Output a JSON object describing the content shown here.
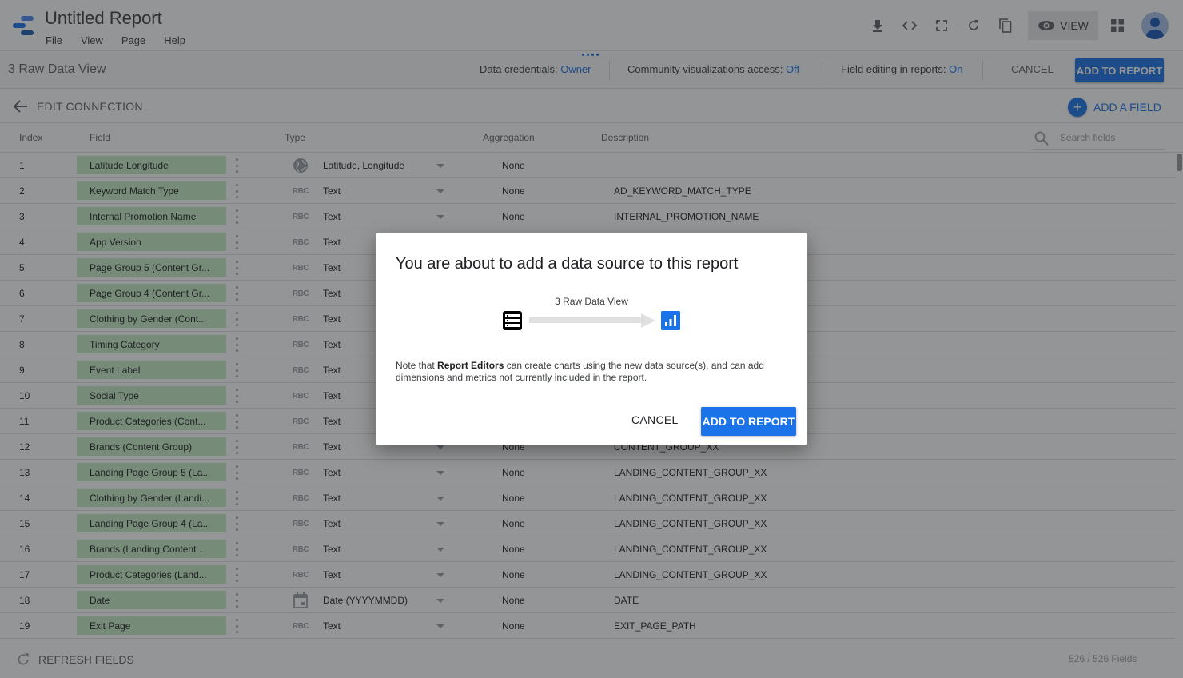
{
  "app": {
    "title": "Untitled Report",
    "menu": [
      "File",
      "View",
      "Page",
      "Help"
    ],
    "toolbar": {
      "download_icon": "download-icon",
      "embed_icon": "code-icon",
      "fullscreen_icon": "fullscreen-icon",
      "refresh_icon": "refresh-icon",
      "copy_icon": "copy-icon",
      "view_label": "VIEW",
      "apps_icon": "apps-grid-icon",
      "avatar_icon": "account-icon"
    }
  },
  "subbar": {
    "datasource_name": "3 Raw Data View",
    "credentials_label": "Data credentials:",
    "credentials_value": "Owner",
    "community_label": "Community visualizations access:",
    "community_value": "Off",
    "field_editing_label": "Field editing in reports:",
    "field_editing_value": "On",
    "cancel_label": "CANCEL",
    "add_label": "ADD TO REPORT"
  },
  "editbar": {
    "back_label": "EDIT CONNECTION",
    "add_field_label": "ADD A FIELD"
  },
  "table": {
    "headers": {
      "index": "Index",
      "field": "Field",
      "type": "Type",
      "aggregation": "Aggregation",
      "description": "Description"
    },
    "search_placeholder": "Search fields",
    "rows": [
      {
        "index": "1",
        "field": "Latitude Longitude",
        "type_icon": "globe",
        "type": "Latitude, Longitude",
        "aggregation": "None",
        "description": ""
      },
      {
        "index": "2",
        "field": "Keyword Match Type",
        "type_icon": "abc",
        "type": "Text",
        "aggregation": "None",
        "description": "AD_KEYWORD_MATCH_TYPE"
      },
      {
        "index": "3",
        "field": "Internal Promotion Name",
        "type_icon": "abc",
        "type": "Text",
        "aggregation": "None",
        "description": "INTERNAL_PROMOTION_NAME"
      },
      {
        "index": "4",
        "field": "App Version",
        "type_icon": "abc",
        "type": "Text",
        "aggregation": "",
        "description": ""
      },
      {
        "index": "5",
        "field": "Page Group 5 (Content Gr...",
        "type_icon": "abc",
        "type": "Text",
        "aggregation": "",
        "description": ""
      },
      {
        "index": "6",
        "field": "Page Group 4 (Content Gr...",
        "type_icon": "abc",
        "type": "Text",
        "aggregation": "",
        "description": ""
      },
      {
        "index": "7",
        "field": "Clothing by Gender (Cont...",
        "type_icon": "abc",
        "type": "Text",
        "aggregation": "",
        "description": ""
      },
      {
        "index": "8",
        "field": "Timing Category",
        "type_icon": "abc",
        "type": "Text",
        "aggregation": "",
        "description": ""
      },
      {
        "index": "9",
        "field": "Event Label",
        "type_icon": "abc",
        "type": "Text",
        "aggregation": "",
        "description": ""
      },
      {
        "index": "10",
        "field": "Social Type",
        "type_icon": "abc",
        "type": "Text",
        "aggregation": "",
        "description": ""
      },
      {
        "index": "11",
        "field": "Product Categories (Cont...",
        "type_icon": "abc",
        "type": "Text",
        "aggregation": "",
        "description": ""
      },
      {
        "index": "12",
        "field": "Brands (Content Group)",
        "type_icon": "abc",
        "type": "Text",
        "aggregation": "None",
        "description": "CONTENT_GROUP_XX"
      },
      {
        "index": "13",
        "field": "Landing Page Group 5 (La...",
        "type_icon": "abc",
        "type": "Text",
        "aggregation": "None",
        "description": "LANDING_CONTENT_GROUP_XX"
      },
      {
        "index": "14",
        "field": "Clothing by Gender (Landi...",
        "type_icon": "abc",
        "type": "Text",
        "aggregation": "None",
        "description": "LANDING_CONTENT_GROUP_XX"
      },
      {
        "index": "15",
        "field": "Landing Page Group 4 (La...",
        "type_icon": "abc",
        "type": "Text",
        "aggregation": "None",
        "description": "LANDING_CONTENT_GROUP_XX"
      },
      {
        "index": "16",
        "field": "Brands (Landing Content ...",
        "type_icon": "abc",
        "type": "Text",
        "aggregation": "None",
        "description": "LANDING_CONTENT_GROUP_XX"
      },
      {
        "index": "17",
        "field": "Product Categories (Land...",
        "type_icon": "abc",
        "type": "Text",
        "aggregation": "None",
        "description": "LANDING_CONTENT_GROUP_XX"
      },
      {
        "index": "18",
        "field": "Date",
        "type_icon": "calendar",
        "type": "Date (YYYYMMDD)",
        "aggregation": "None",
        "description": "DATE"
      },
      {
        "index": "19",
        "field": "Exit Page",
        "type_icon": "abc",
        "type": "Text",
        "aggregation": "None",
        "description": "EXIT_PAGE_PATH"
      }
    ]
  },
  "footer": {
    "refresh_label": "REFRESH FIELDS",
    "field_count": "526 / 526 Fields"
  },
  "dialog": {
    "title": "You are about to add a data source to this report",
    "source_name": "3 Raw Data View",
    "note_prefix": "Note that ",
    "note_bold": "Report Editors",
    "note_suffix": " can create charts using the new data source(s), and can add dimensions and metrics not currently included in the report.",
    "cancel_label": "CANCEL",
    "add_label": "ADD TO REPORT"
  },
  "colors": {
    "accent": "#1a73e8",
    "field_chip": "#c8ecc8",
    "scrim": "rgba(32,33,36,0.48)"
  }
}
